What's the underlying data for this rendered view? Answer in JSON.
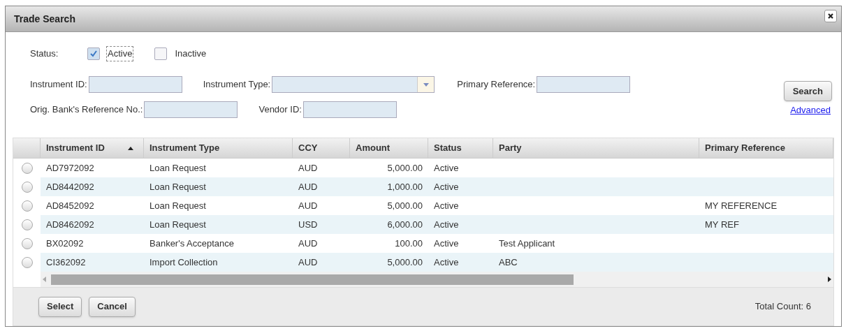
{
  "window": {
    "title": "Trade Search"
  },
  "status_filter": {
    "label": "Status:",
    "options": [
      {
        "label": "Active",
        "checked": true
      },
      {
        "label": "Inactive",
        "checked": false
      }
    ]
  },
  "fields": [
    {
      "label": "Instrument ID:",
      "kind": "text"
    },
    {
      "label": "Instrument Type:",
      "kind": "dropdown"
    },
    {
      "label": "Primary Reference:",
      "kind": "text"
    },
    {
      "label": "Orig. Bank's Reference No.:",
      "kind": "text"
    },
    {
      "label": "Vendor ID:",
      "kind": "text"
    }
  ],
  "search_button": "Search",
  "advanced_link": "Advanced",
  "table": {
    "columns": [
      {
        "label": "Instrument ID",
        "sorted": true
      },
      {
        "label": "Instrument Type",
        "sorted": false
      },
      {
        "label": "CCY",
        "sorted": false
      },
      {
        "label": "Amount",
        "sorted": false
      },
      {
        "label": "Status",
        "sorted": false
      },
      {
        "label": "Party",
        "sorted": false
      },
      {
        "label": "Primary Reference",
        "sorted": false
      }
    ],
    "rows": [
      {
        "selected": false,
        "cells": [
          "AD7972092",
          "Loan Request",
          "AUD",
          "5,000.00",
          "Active",
          "",
          ""
        ]
      },
      {
        "selected": false,
        "cells": [
          "AD8442092",
          "Loan Request",
          "AUD",
          "1,000.00",
          "Active",
          "",
          ""
        ]
      },
      {
        "selected": false,
        "cells": [
          "AD8452092",
          "Loan Request",
          "AUD",
          "5,000.00",
          "Active",
          "",
          "MY REFERENCE"
        ]
      },
      {
        "selected": false,
        "cells": [
          "AD8462092",
          "Loan Request",
          "USD",
          "6,000.00",
          "Active",
          "",
          "MY REF"
        ]
      },
      {
        "selected": false,
        "cells": [
          "BX02092",
          "Banker's Acceptance",
          "AUD",
          "100.00",
          "Active",
          "Test Applicant",
          ""
        ]
      },
      {
        "selected": false,
        "cells": [
          "CI362092",
          "Import Collection",
          "AUD",
          "5,000.00",
          "Active",
          "ABC",
          ""
        ]
      }
    ]
  },
  "footer": {
    "buttons": [
      "Select",
      "Cancel"
    ],
    "total_count": "Total Count: 6"
  }
}
